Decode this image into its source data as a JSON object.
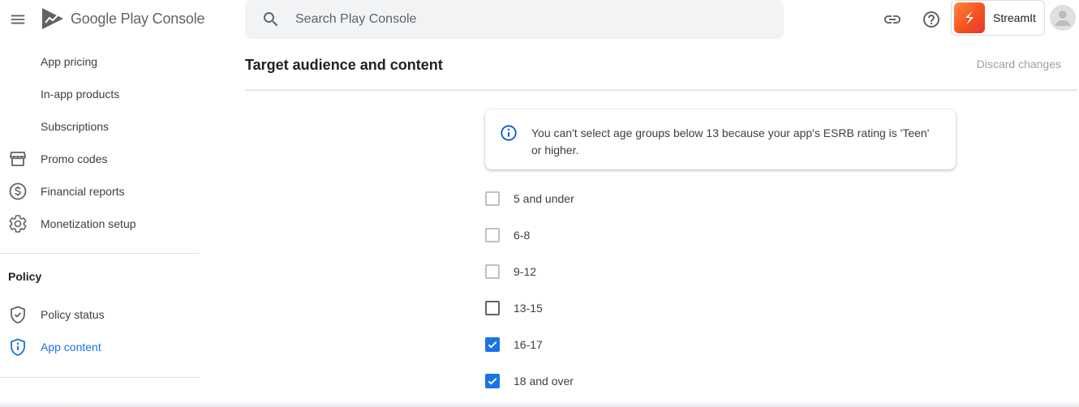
{
  "header": {
    "logo_text": "Google Play Console",
    "search_placeholder": "Search Play Console",
    "app_name": "StreamIt"
  },
  "sidebar": {
    "items": [
      {
        "label": "App pricing",
        "icon": "none"
      },
      {
        "label": "In-app products",
        "icon": "none"
      },
      {
        "label": "Subscriptions",
        "icon": "none"
      },
      {
        "label": "Promo codes",
        "icon": "storefront-icon"
      },
      {
        "label": "Financial reports",
        "icon": "dollar-circle-icon"
      },
      {
        "label": "Monetization setup",
        "icon": "gear-icon"
      }
    ],
    "section_title": "Policy",
    "policy_items": [
      {
        "label": "Policy status",
        "icon": "shield-check-icon"
      },
      {
        "label": "App content",
        "icon": "shield-info-icon",
        "active": true
      }
    ]
  },
  "page": {
    "title": "Target audience and content",
    "discard_label": "Discard changes",
    "info_text": "You can't select age groups below 13 because your app's ESRB rating is 'Teen' or higher.",
    "age_groups": [
      {
        "label": "5 and under",
        "checked": false,
        "disabled": true
      },
      {
        "label": "6-8",
        "checked": false,
        "disabled": true
      },
      {
        "label": "9-12",
        "checked": false,
        "disabled": true
      },
      {
        "label": "13-15",
        "checked": false,
        "disabled": false
      },
      {
        "label": "16-17",
        "checked": true,
        "disabled": false
      },
      {
        "label": "18 and over",
        "checked": true,
        "disabled": false
      }
    ]
  },
  "colors": {
    "accent": "#1a73e8",
    "info_icon": "#0b57d0"
  }
}
